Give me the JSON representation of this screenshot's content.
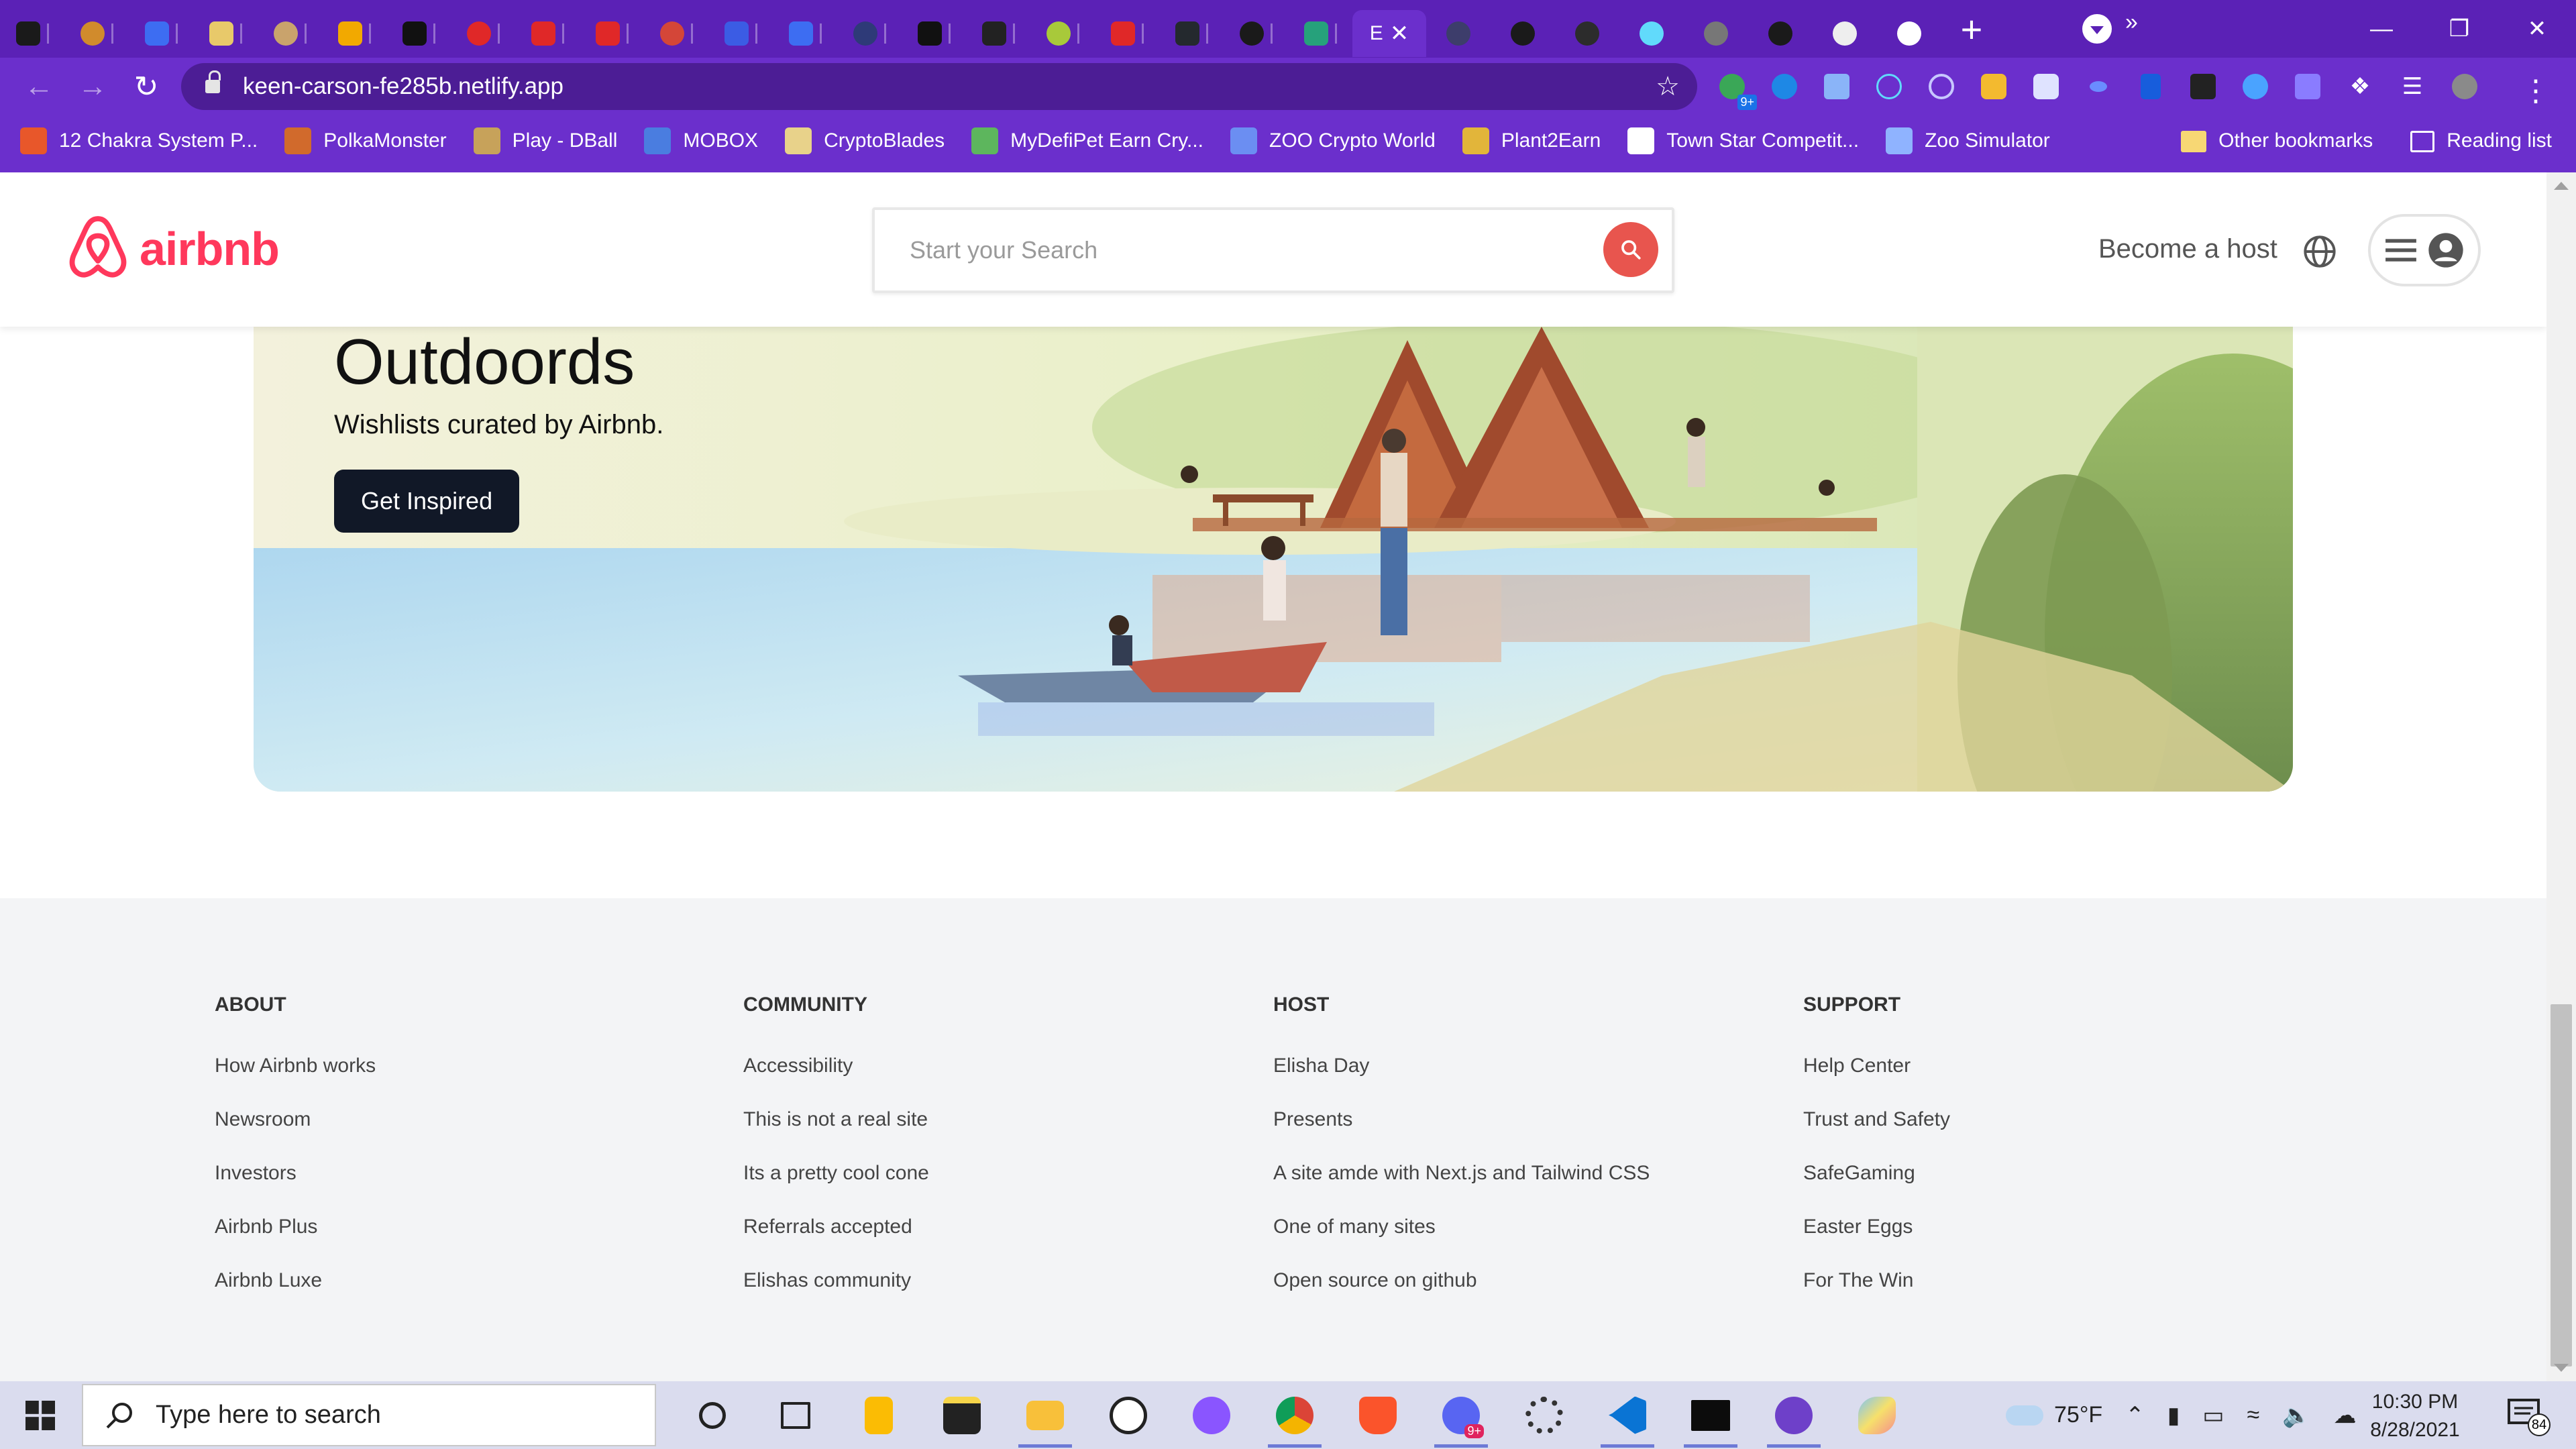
{
  "browser": {
    "url": "keen-carson-fe285b.netlify.app",
    "active_tab_label": "E",
    "tab_colors": [
      "#1a1a1a",
      "#d18b2c",
      "#3d6df2",
      "#e8c96a",
      "#c9a36c",
      "#f2a900",
      "#111111",
      "#e02828",
      "#e02828",
      "#e02828",
      "#d44638",
      "#3b5ce4",
      "#3d6df2",
      "#2e3a78",
      "#111111",
      "#222222",
      "#a8c93a",
      "#e02828",
      "#24292e",
      "#1a1a1a",
      "#26a17b"
    ],
    "window_controls": {
      "minimize": "—",
      "restore": "❐",
      "close": "✕"
    }
  },
  "bookmarks": {
    "items": [
      {
        "label": "12 Chakra System P...",
        "color": "#e8572a"
      },
      {
        "label": "PolkaMonster",
        "color": "#d16a2c"
      },
      {
        "label": "Play - DBall",
        "color": "#c7a25a"
      },
      {
        "label": "MOBOX",
        "color": "#4a7de0"
      },
      {
        "label": "CryptoBlades",
        "color": "#e8d28a"
      },
      {
        "label": "MyDefiPet Earn Cry...",
        "color": "#5db65d"
      },
      {
        "label": "ZOO Crypto World",
        "color": "#6b8ef2"
      },
      {
        "label": "Plant2Earn",
        "color": "#e2b53a"
      },
      {
        "label": "Town Star Competit...",
        "color": "#ffffff"
      },
      {
        "label": "Zoo Simulator",
        "color": "#8fb3ff"
      }
    ],
    "more": "»",
    "other": "Other bookmarks",
    "reading": "Reading list"
  },
  "header": {
    "logo": "airbnb",
    "search_placeholder": "Start your Search",
    "become_host": "Become a host"
  },
  "hero": {
    "title": "Outdoords",
    "subtitle": "Wishlists curated by Airbnb.",
    "button": "Get Inspired"
  },
  "footer": {
    "columns": [
      {
        "title": "ABOUT",
        "items": [
          "How Airbnb works",
          "Newsroom",
          "Investors",
          "Airbnb Plus",
          "Airbnb Luxe"
        ]
      },
      {
        "title": "COMMUNITY",
        "items": [
          "Accessibility",
          "This is not a real site",
          "Its a pretty cool cone",
          "Referrals accepted",
          "Elishas community"
        ]
      },
      {
        "title": "HOST",
        "items": [
          "Elisha Day",
          "Presents",
          "A site amde with Next.js and Tailwind CSS",
          "One of many sites",
          "Open source on github"
        ]
      },
      {
        "title": "SUPPORT",
        "items": [
          "Help Center",
          "Trust and Safety",
          "SafeGaming",
          "Easter Eggs",
          "For The Win"
        ]
      }
    ]
  },
  "taskbar": {
    "search_placeholder": "Type here to search",
    "weather": "75°F",
    "time": "10:30 PM",
    "date": "8/28/2021",
    "notification_count": "84",
    "discord_badge": "9+",
    "ext_badge": "9+"
  },
  "colors": {
    "brand": "#ff385c",
    "browser_theme": "#6b2fcc",
    "search_button": "#e8554e",
    "hero_button": "#111827",
    "footer_bg": "#f3f4f6"
  }
}
